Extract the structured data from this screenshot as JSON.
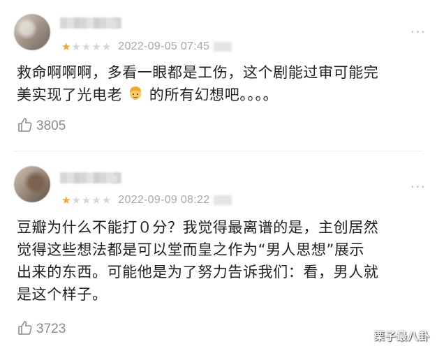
{
  "comments": [
    {
      "stars_filled": 1,
      "stars_total": 5,
      "timestamp": "2022-09-05 07:45",
      "text_line1": "救命啊啊啊，多看一眼都是工伤，这个剧能过审可能完",
      "text_line2_a": "美实现了光电老",
      "text_line2_b": "的所有幻想吧。。。。",
      "likes": "3805"
    },
    {
      "stars_filled": 1,
      "stars_total": 5,
      "timestamp": "2022-09-09 08:22",
      "text_lines": [
        "豆瓣为什么不能打０分？我觉得最离谱的是，主创居然",
        "觉得这些想法都是可以堂而皇之作为“男人思想”展示",
        "出来的东西。可能他是为了努力告诉我们：看，男人就",
        "是这个样子。"
      ],
      "likes": "3723"
    }
  ],
  "more_glyph": "···",
  "watermark": "栗子最八卦",
  "colors": {
    "star_on": "#f5a623",
    "star_off": "#d6d6d6",
    "text": "#202020",
    "meta": "#a7a7a7"
  },
  "icons": [
    "avatar",
    "star-icon",
    "more-icon",
    "thumbs-up-icon",
    "man-emoji-icon"
  ]
}
